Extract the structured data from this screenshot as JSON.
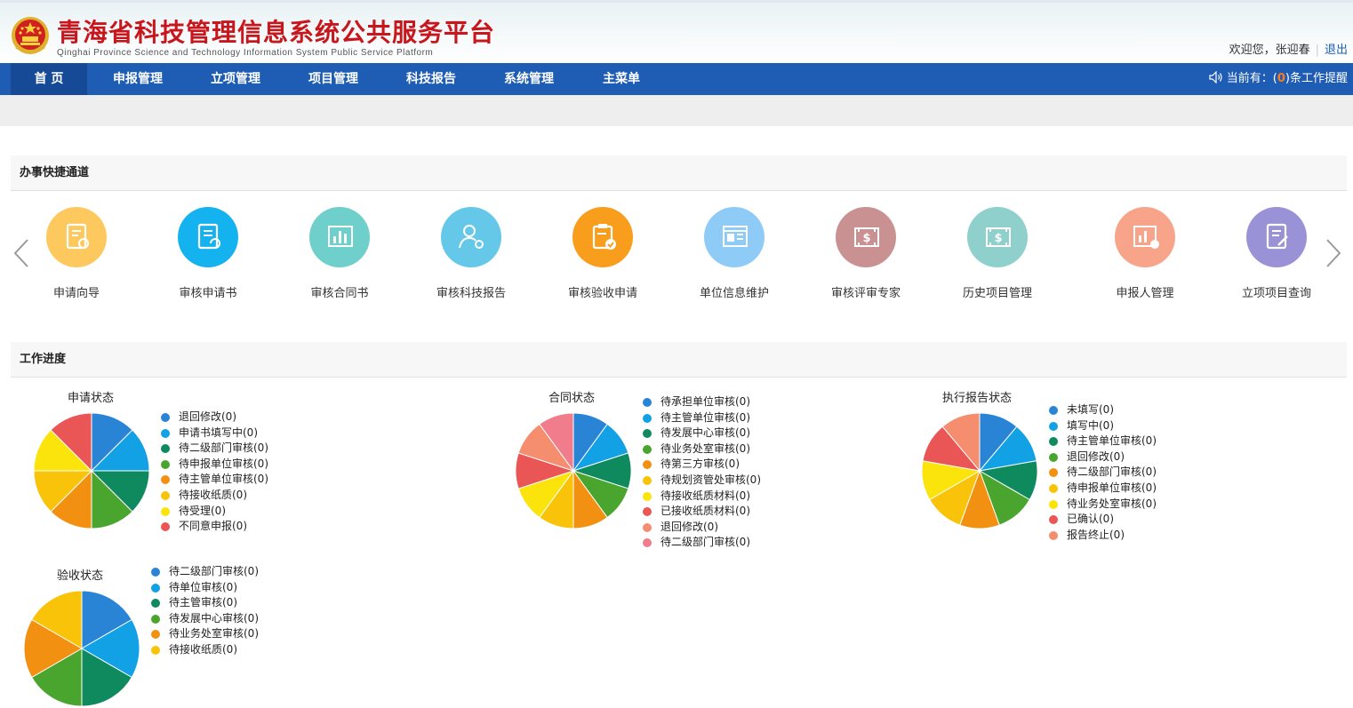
{
  "header": {
    "title_cn": "青海省科技管理信息系统公共服务平台",
    "title_en": "Qinghai Province Science and Technology Information System Public Service Platform",
    "welcome": "欢迎您，张迎春",
    "logout": "退出"
  },
  "nav": {
    "items": [
      "首 页",
      "申报管理",
      "立项管理",
      "项目管理",
      "科技报告",
      "系统管理",
      "主菜单"
    ],
    "notice_prefix": "当前有：(",
    "notice_count": "0",
    "notice_suffix": ")条工作提醒"
  },
  "quick_access": {
    "title": "办事快捷通道",
    "items": [
      {
        "label": "申请向导",
        "color": "#fdc95e",
        "icon": "document-certificate-icon"
      },
      {
        "label": "审核申请书",
        "color": "#14b3f0",
        "icon": "document-refresh-icon"
      },
      {
        "label": "审核合同书",
        "color": "#6fcfca",
        "icon": "bar-chart-icon"
      },
      {
        "label": "审核科技报告",
        "color": "#66c8e8",
        "icon": "user-gear-icon"
      },
      {
        "label": "审核验收申请",
        "color": "#f99e1c",
        "icon": "clipboard-check-icon"
      },
      {
        "label": "单位信息维护",
        "color": "#8fcbf7",
        "icon": "browser-window-icon"
      },
      {
        "label": "审核评审专家",
        "color": "#c99191",
        "icon": "money-card-icon"
      },
      {
        "label": "历史项目管理",
        "color": "#8fcfcc",
        "icon": "money-card-icon"
      },
      {
        "label": "申报人管理",
        "color": "#f8a48a",
        "icon": "chart-gear-icon"
      },
      {
        "label": "立项项目查询",
        "color": "#9a92d6",
        "icon": "document-edit-icon"
      }
    ]
  },
  "progress": {
    "title": "工作进度"
  },
  "colors": {
    "palette": [
      "#2a84d6",
      "#11a1e4",
      "#0f8a5f",
      "#4aa52e",
      "#f29111",
      "#f8c309",
      "#fbe30c",
      "#ea5555",
      "#f58d6f",
      "#f07c8c"
    ]
  },
  "chart_data": [
    {
      "type": "pie",
      "title": "申请状态",
      "labels": [
        "退回修改(0)",
        "申请书填写中(0)",
        "待二级部门审核(0)",
        "待申报单位审核(0)",
        "待主管单位审核(0)",
        "待接收纸质(0)",
        "待受理(0)",
        "不同意申报(0)"
      ],
      "values": [
        0,
        0,
        0,
        0,
        0,
        0,
        0,
        0
      ],
      "colors": [
        "#2a84d6",
        "#11a1e4",
        "#0f8a5f",
        "#4aa52e",
        "#f29111",
        "#f8c309",
        "#fbe30c",
        "#ea5555"
      ]
    },
    {
      "type": "pie",
      "title": "合同状态",
      "labels": [
        "待承担单位审核(0)",
        "待主管单位审核(0)",
        "待发展中心审核(0)",
        "待业务处室审核(0)",
        "待第三方审核(0)",
        "待规划资管处审核(0)",
        "待接收纸质材料(0)",
        "已接收纸质材料(0)",
        "退回修改(0)",
        "待二级部门审核(0)"
      ],
      "values": [
        0,
        0,
        0,
        0,
        0,
        0,
        0,
        0,
        0,
        0
      ],
      "colors": [
        "#2a84d6",
        "#11a1e4",
        "#0f8a5f",
        "#4aa52e",
        "#f29111",
        "#f8c309",
        "#fbe30c",
        "#ea5555",
        "#f58d6f",
        "#f07c8c"
      ]
    },
    {
      "type": "pie",
      "title": "执行报告状态",
      "labels": [
        "未填写(0)",
        "填写中(0)",
        "待主管单位审核(0)",
        "退回修改(0)",
        "待二级部门审核(0)",
        "待申报单位审核(0)",
        "待业务处室审核(0)",
        "已确认(0)",
        "报告终止(0)"
      ],
      "values": [
        0,
        0,
        0,
        0,
        0,
        0,
        0,
        0,
        0
      ],
      "colors": [
        "#2a84d6",
        "#11a1e4",
        "#0f8a5f",
        "#4aa52e",
        "#f29111",
        "#f8c309",
        "#fbe30c",
        "#ea5555",
        "#f58d6f"
      ]
    },
    {
      "type": "pie",
      "title": "验收状态",
      "labels": [
        "待二级部门审核(0)",
        "待单位审核(0)",
        "待主管审核(0)",
        "待发展中心审核(0)",
        "待业务处室审核(0)",
        "待接收纸质(0)"
      ],
      "values": [
        0,
        0,
        0,
        0,
        0,
        0
      ],
      "colors": [
        "#2a84d6",
        "#11a1e4",
        "#0f8a5f",
        "#4aa52e",
        "#f29111",
        "#f8c309",
        "#fbe30c",
        "#ea5555",
        "#f58d6f",
        "#f07c8c"
      ]
    }
  ]
}
